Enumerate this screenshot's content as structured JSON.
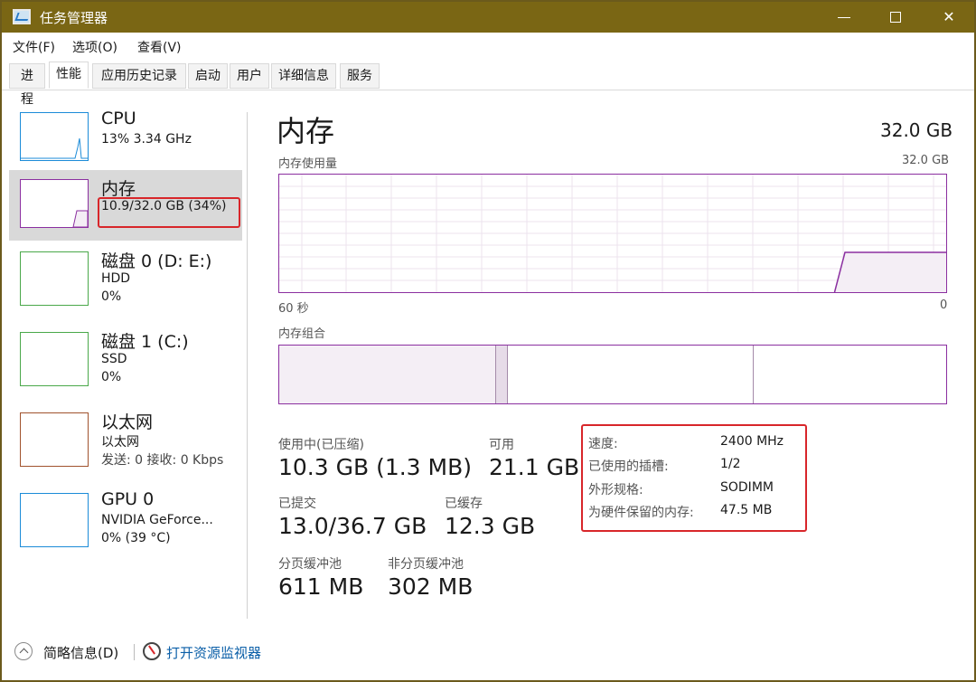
{
  "window": {
    "title": "任务管理器"
  },
  "menu": [
    "文件(F)",
    "选项(O)",
    "查看(V)"
  ],
  "tabs": [
    "进程",
    "性能",
    "应用历史记录",
    "启动",
    "用户",
    "详细信息",
    "服务"
  ],
  "active_tab": "性能",
  "sidebar": {
    "items": [
      {
        "name": "CPU",
        "line1": "13% 3.34 GHz",
        "line2": "",
        "color": "#1b8bd8"
      },
      {
        "name": "内存",
        "line1": "10.9/32.0 GB (34%)",
        "line2": "",
        "color": "#8b2fa0"
      },
      {
        "name": "磁盘 0 (D: E:)",
        "line1": "HDD",
        "line2": "0%",
        "color": "#4aa84a"
      },
      {
        "name": "磁盘 1 (C:)",
        "line1": "SSD",
        "line2": "0%",
        "color": "#4aa84a"
      },
      {
        "name": "以太网",
        "line1": "以太网",
        "line2": "发送: 0 接收: 0 Kbps",
        "color": "#a0522d"
      },
      {
        "name": "GPU 0",
        "line1": "NVIDIA GeForce...",
        "line2": "0% (39 °C)",
        "color": "#1b8bd8"
      }
    ]
  },
  "main": {
    "title": "内存",
    "total": "32.0 GB",
    "usage_label": "内存使用量",
    "usage_max": "32.0 GB",
    "time_left": "60 秒",
    "time_right": "0",
    "composition_label": "内存组合",
    "stats": {
      "in_use_label": "使用中(已压缩)",
      "in_use_value": "10.3 GB (1.3 MB)",
      "available_label": "可用",
      "available_value": "21.1 GB",
      "committed_label": "已提交",
      "committed_value": "13.0/36.7 GB",
      "cached_label": "已缓存",
      "cached_value": "12.3 GB",
      "paged_label": "分页缓冲池",
      "paged_value": "611 MB",
      "nonpaged_label": "非分页缓冲池",
      "nonpaged_value": "302 MB"
    },
    "details": [
      {
        "key": "速度:",
        "value": "2400 MHz"
      },
      {
        "key": "已使用的插槽:",
        "value": "1/2"
      },
      {
        "key": "外形规格:",
        "value": "SODIMM"
      },
      {
        "key": "为硬件保留的内存:",
        "value": "47.5 MB"
      }
    ]
  },
  "footer": {
    "fewer_details": "简略信息(D)",
    "resource_monitor": "打开资源监视器"
  },
  "colors": {
    "accent": "#8b2fa0",
    "highlight": "#d8262a",
    "titlebar": "#7a6614"
  }
}
